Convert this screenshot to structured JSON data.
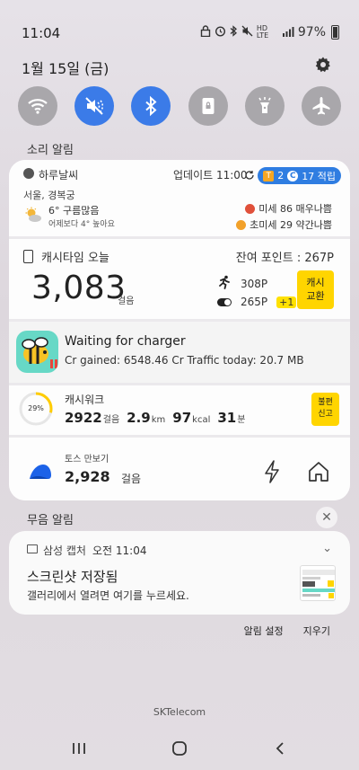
{
  "status_bar": {
    "time": "11:04",
    "network": "HD LTE",
    "battery": "97%"
  },
  "header": {
    "date": "1월 15일 (금)"
  },
  "quick_settings": [
    {
      "name": "wifi",
      "active": false
    },
    {
      "name": "sound-mute",
      "active": true
    },
    {
      "name": "bluetooth",
      "active": true
    },
    {
      "name": "portrait-lock",
      "active": false
    },
    {
      "name": "flashlight",
      "active": false
    },
    {
      "name": "airplane-mode",
      "active": false
    }
  ],
  "sections": {
    "sound_alerts": "소리 알림",
    "silent_alerts": "무음 알림"
  },
  "weather": {
    "app": "하루날씨",
    "update": "업데이트 11:00",
    "badge_t": "T",
    "badge_t_value": "2",
    "badge_c": "C",
    "badge_c_value": "17 적립",
    "location": "서울, 경복궁",
    "temp": "6° 구름많음",
    "compare": "어제보다 4° 높아요",
    "fine_dust": "미세 86 매우나쁨",
    "ultra_fine_dust": "초미세 29 약간나쁨"
  },
  "cashtime": {
    "title": "캐시타임 오늘",
    "remaining": "잔여 포인트 : 267P",
    "steps": "3,083",
    "steps_unit": "걸음",
    "walk_points": "308P",
    "other_points": "265P",
    "bonus": "+1",
    "exchange_line1": "캐시",
    "exchange_line2": "교환"
  },
  "charger": {
    "title": "Waiting for charger",
    "subtitle": "Cr gained: 6548.46 Cr  Traffic today: 20.7 MB"
  },
  "cashwalk": {
    "title": "캐시워크",
    "percent": "29%",
    "progress": 0.29,
    "steps": "2922",
    "steps_unit": "걸음",
    "distance": "2.9",
    "distance_unit": "km",
    "kcal": "97",
    "kcal_unit": "kcal",
    "minutes": "31",
    "minutes_unit": "분",
    "report_line1": "불편",
    "report_line2": "신고"
  },
  "toss": {
    "title": "토스 만보기",
    "steps": "2,928",
    "steps_unit": "걸음"
  },
  "capture": {
    "app": "삼성 캡처",
    "time": "오전 11:04",
    "title": "스크린샷 저장됨",
    "body": "갤러리에서 열려면 여기를 누르세요."
  },
  "footer": {
    "settings": "알림 설정",
    "clear": "지우기",
    "carrier": "SKTelecom"
  },
  "colors": {
    "accent_blue": "#3b7be8",
    "yellow": "#ffd500"
  }
}
